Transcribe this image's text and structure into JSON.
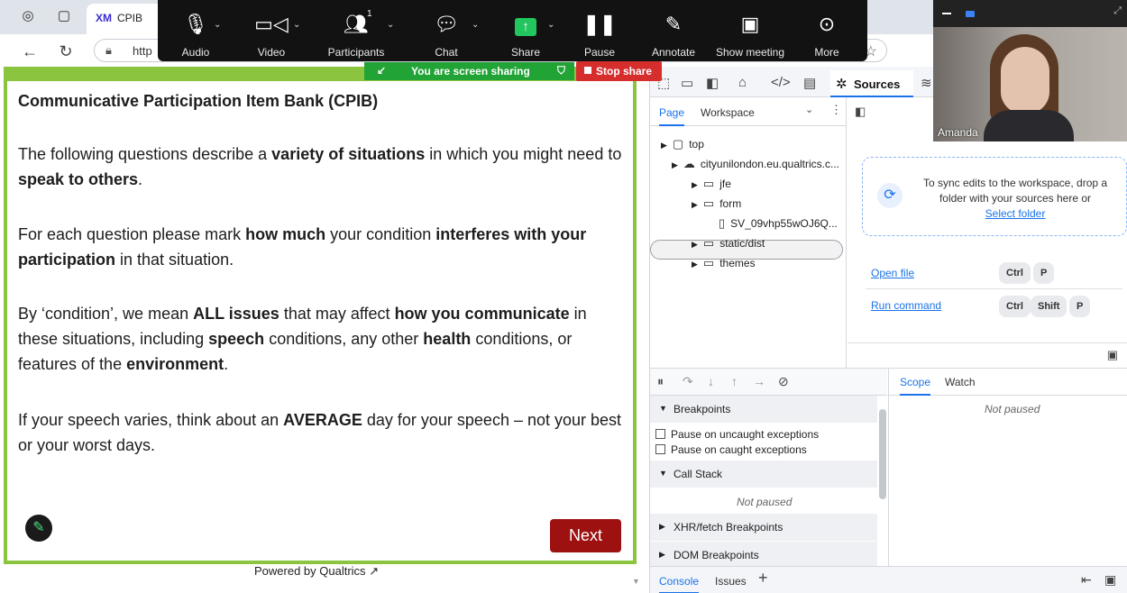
{
  "browser": {
    "tab_title": "CPIB",
    "tab_logo": "XM",
    "url_text": "http",
    "icons": [
      "tab-groups-icon",
      "tab-list-icon",
      "back-icon",
      "reload-icon",
      "lock-icon",
      "star-icon"
    ]
  },
  "zoom_toolbar": {
    "buttons": [
      {
        "label": "Audio",
        "icon": "microphone-icon"
      },
      {
        "label": "Video",
        "icon": "video-camera-icon"
      },
      {
        "label": "Participants",
        "icon": "participants-icon",
        "count": "1"
      },
      {
        "label": "Chat",
        "icon": "chat-icon"
      },
      {
        "label": "Share",
        "icon": "share-up-arrow-icon"
      },
      {
        "label": "Pause",
        "icon": "pause-icon"
      },
      {
        "label": "Annotate",
        "icon": "pencil-icon"
      },
      {
        "label": "Show meeting",
        "icon": "show-meeting-icon"
      },
      {
        "label": "More",
        "icon": "more-dots-icon"
      }
    ],
    "sharing_text": "You are screen sharing",
    "stop_share": "Stop share"
  },
  "survey": {
    "title": "Communicative Participation Item Bank (CPIB)",
    "next": "Next",
    "powered_by": "Powered by Qualtrics"
  },
  "devtools": {
    "sources_tab": "Sources",
    "nav_tabs": [
      "Page",
      "Workspace"
    ],
    "tree": [
      {
        "label": "top"
      },
      {
        "label": "cityunilondon.eu.qualtrics.c..."
      },
      {
        "label": "jfe"
      },
      {
        "label": "form"
      },
      {
        "label": "SV_09vhp55wOJ6Q..."
      },
      {
        "label": "static/dist"
      },
      {
        "label": "themes"
      }
    ],
    "drop_text": "To sync edits to the workspace, drop a folder with your sources here or",
    "select_folder": "Select folder",
    "open_file": "Open file",
    "run_command": "Run command",
    "keys": {
      "ctrl": "Ctrl",
      "p": "P",
      "shift": "Shift"
    },
    "breakpoints": "Breakpoints",
    "pause_uncaught": "Pause on uncaught exceptions",
    "pause_caught": "Pause on caught exceptions",
    "call_stack": "Call Stack",
    "not_paused": "Not paused",
    "xhr_breakpoints": "XHR/fetch Breakpoints",
    "dom_breakpoints": "DOM Breakpoints",
    "scope_tabs": [
      "Scope",
      "Watch"
    ],
    "console_tabs": [
      "Console",
      "Issues"
    ]
  },
  "video": {
    "name": "Amanda"
  },
  "colors": {
    "qualtrics_green": "#8bc53f",
    "next_button": "#9e1111",
    "share_green": "#21a336",
    "stop_red": "#d62d2d",
    "devtools_blue": "#1a73e8"
  }
}
